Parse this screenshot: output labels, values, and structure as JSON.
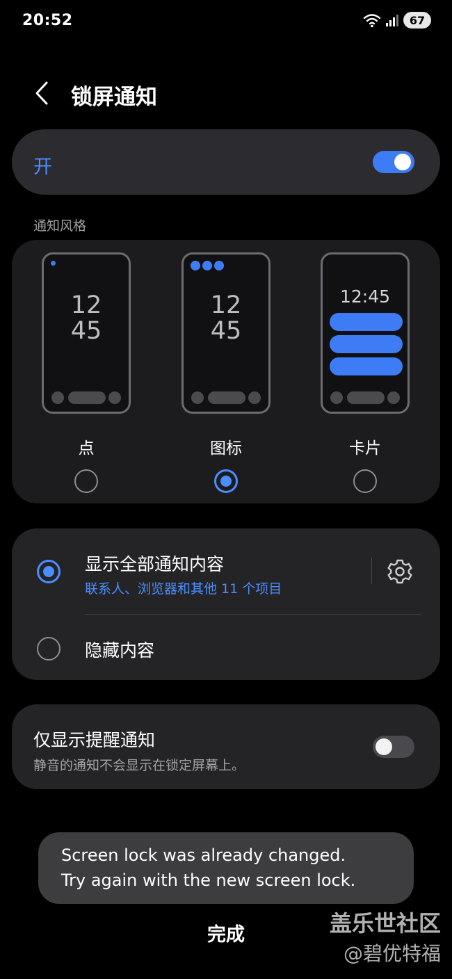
{
  "status_bar": {
    "time": "20:52",
    "battery": "67"
  },
  "header": {
    "title": "锁屏通知"
  },
  "master": {
    "label": "开",
    "enabled": true
  },
  "notification_style": {
    "section_label": "通知风格",
    "options": [
      {
        "label": "点",
        "selected": false,
        "clock_hour": "12",
        "clock_minute": "45"
      },
      {
        "label": "图标",
        "selected": true,
        "clock_hour": "12",
        "clock_minute": "45"
      },
      {
        "label": "卡片",
        "selected": false,
        "clock": "12:45"
      }
    ]
  },
  "content_visibility": {
    "show_all": {
      "title": "显示全部通知内容",
      "subtitle": "联系人、浏览器和其他 11 个项目",
      "selected": true
    },
    "hide": {
      "title": "隐藏内容",
      "selected": false
    }
  },
  "reminder_only": {
    "title": "仅显示提醒通知",
    "subtitle": "静音的通知不会显示在锁定屏幕上。",
    "enabled": false
  },
  "toast": {
    "line1": "Screen lock was already changed.",
    "line2": "Try again with the new screen lock."
  },
  "footer": {
    "done_label": "完成"
  },
  "watermark": {
    "line1": "盖乐世社区",
    "line2": "@碧优特福"
  },
  "colors": {
    "accent": "#3e7cf6",
    "accent_text": "#4c8dff",
    "card": "#242427",
    "background": "#000000"
  }
}
